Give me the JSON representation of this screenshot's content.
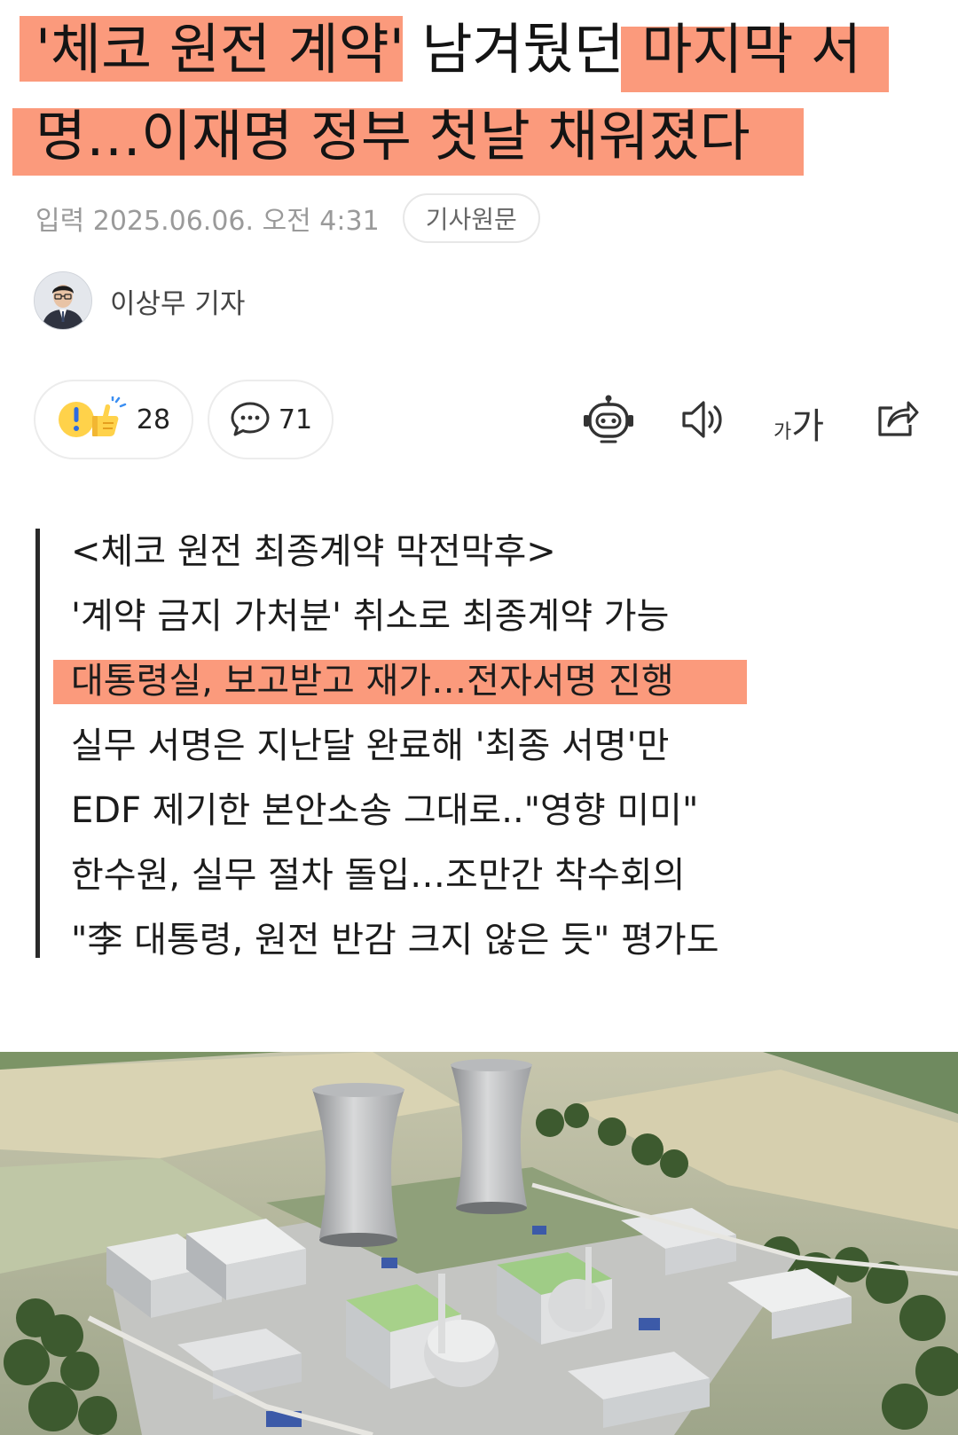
{
  "article": {
    "headline_lines": [
      "'체코 원전 계약' 남겨뒀던 마지막 서",
      "명…이재명 정부 첫날 채워졌다"
    ],
    "date": "입력 2025.06.06. 오전 4:31",
    "source_button": "기사원문",
    "author": "이상무 기자"
  },
  "reactions": {
    "like_count": "28",
    "comment_count": "71"
  },
  "toolbar": {
    "font_size_label_small": "가",
    "font_size_label_large": "가"
  },
  "summary": {
    "lines": [
      "<체코 원전 최종계약 막전막후>",
      "'계약 금지 가처분' 취소로 최종계약 가능",
      "대통령실, 보고받고 재가…전자서명 진행",
      "실무 서명은 지난달 완료해 '최종 서명'만",
      "EDF 제기한 본안소송 그대로..\"영향 미미\"",
      "한수원, 실무 절차 돌입…조만간 착수회의",
      "\"李 대통령, 원전 반감 크지 않은 듯\" 평가도"
    ]
  },
  "colors": {
    "highlight": "#fb9a7c",
    "muted_text": "#9a9a9a",
    "pill_border": "#ececec"
  },
  "icons": {
    "reaction": "idea-thumbs-up-icon",
    "comment": "speech-bubble-icon",
    "ai": "robot-icon",
    "tts": "speaker-icon",
    "share": "share-arrow-icon"
  }
}
